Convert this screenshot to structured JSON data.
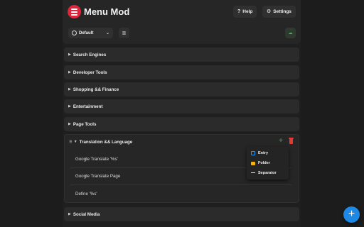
{
  "header": {
    "title": "Menu Mod",
    "help_label": "Help",
    "settings_label": "Settings",
    "profile_label": "Default",
    "profile_icon": "user-circle-icon",
    "chevron_icon": "chevron-down-icon",
    "reorder_icon": "columns-icon",
    "sync_icon": "cloud-sync-icon"
  },
  "folders": [
    {
      "label": "Search Engines"
    },
    {
      "label": "Developer Tools"
    },
    {
      "label": "Shopping && Finance"
    },
    {
      "label": "Entertainment"
    },
    {
      "label": "Page Tools"
    }
  ],
  "open_folder": {
    "label": "Translation && Language",
    "entries": [
      {
        "label": "Google Translate '%s'"
      },
      {
        "label": "Google Translate Page"
      },
      {
        "label": "Define '%s'"
      }
    ]
  },
  "bottom_folder": {
    "label": "Social Media"
  },
  "add_menu": {
    "items": [
      {
        "label": "Entry",
        "icon": "link-icon"
      },
      {
        "label": "Folder",
        "icon": "folder-icon"
      },
      {
        "label": "Separator",
        "icon": "separator-icon"
      }
    ]
  },
  "colors": {
    "brand": "#e0243b",
    "add": "#4caf50",
    "delete": "#e53935",
    "fab": "#1e88e5"
  }
}
